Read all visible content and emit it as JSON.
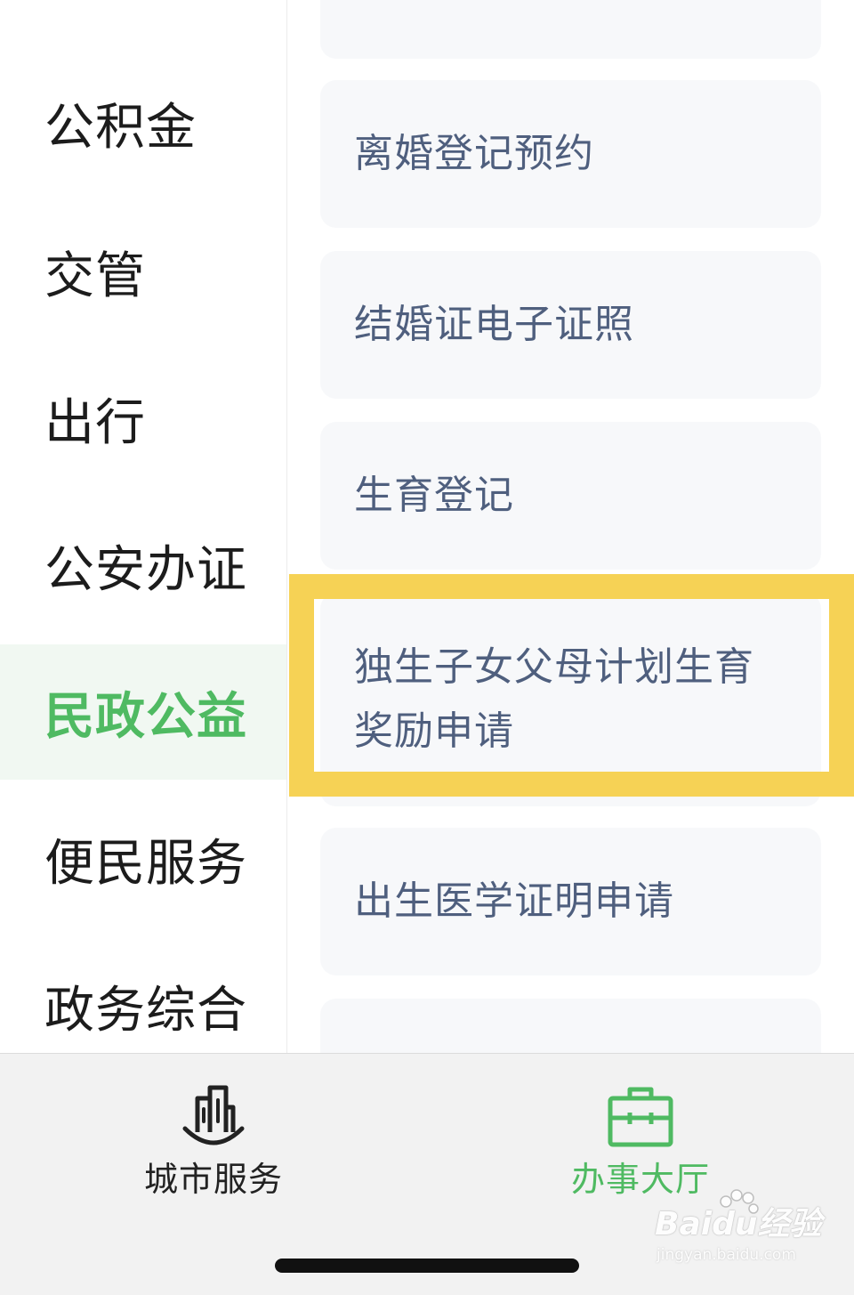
{
  "sidebar": {
    "items": [
      {
        "label": "公积金"
      },
      {
        "label": "交管"
      },
      {
        "label": "出行"
      },
      {
        "label": "公安办证"
      },
      {
        "label": "民政公益",
        "active": true
      },
      {
        "label": "便民服务"
      },
      {
        "label": "政务综合"
      }
    ]
  },
  "services": {
    "items": [
      {
        "label": "离婚登记预约"
      },
      {
        "label": "结婚证电子证照"
      },
      {
        "label": "生育登记"
      },
      {
        "label": "独生子女父母计划生育奖励申请",
        "highlighted": true
      },
      {
        "label": "出生医学证明申请"
      }
    ]
  },
  "tabbar": {
    "tabs": [
      {
        "label": "城市服务",
        "icon": "city-buildings-icon",
        "active": false
      },
      {
        "label": "办事大厅",
        "icon": "briefcase-icon",
        "active": true
      }
    ]
  },
  "watermark": {
    "brand": "Baidu经验",
    "sub": "jingyan.baidu.com"
  },
  "colors": {
    "accent": "#4fba62",
    "highlight_border": "#f6d255",
    "card_text": "#4f5f7e",
    "card_bg": "#f7f8fa",
    "sidebar_active_bg": "#f1f8f2"
  }
}
